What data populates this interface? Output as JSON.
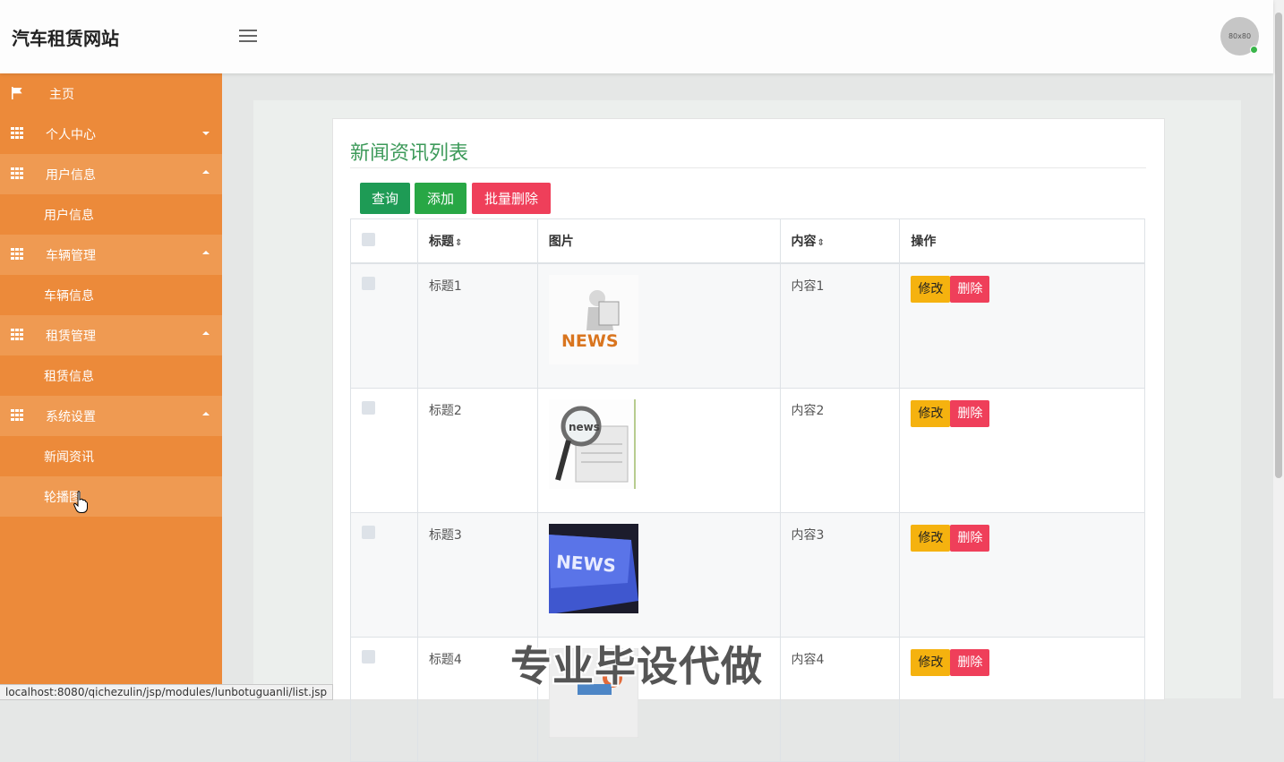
{
  "header": {
    "brand": "汽车租赁网站",
    "avatar_text": "80x80"
  },
  "sidebar": {
    "items": [
      {
        "label": "主页",
        "icon": "flag-icon",
        "type": "link"
      },
      {
        "label": "个人中心",
        "icon": "grid-icon",
        "type": "group",
        "expanded": false
      },
      {
        "label": "用户信息",
        "icon": "grid-icon",
        "type": "group",
        "expanded": true,
        "children": [
          "用户信息"
        ]
      },
      {
        "label": "车辆管理",
        "icon": "grid-icon",
        "type": "group",
        "expanded": true,
        "children": [
          "车辆信息"
        ]
      },
      {
        "label": "租赁管理",
        "icon": "grid-icon",
        "type": "group",
        "expanded": true,
        "children": [
          "租赁信息"
        ]
      },
      {
        "label": "系统设置",
        "icon": "grid-icon",
        "type": "group",
        "expanded": true,
        "children": [
          "新闻资讯",
          "轮播图"
        ]
      }
    ]
  },
  "main": {
    "title": "新闻资讯列表",
    "buttons": {
      "query": "查询",
      "add": "添加",
      "batch_delete": "批量删除"
    },
    "table": {
      "headers": {
        "title": "标题",
        "image": "图片",
        "content": "内容",
        "actions": "操作"
      },
      "rows": [
        {
          "title": "标题1",
          "content": "内容1",
          "image": "news-3d-figure-image"
        },
        {
          "title": "标题2",
          "content": "内容2",
          "image": "news-magnifier-image"
        },
        {
          "title": "标题3",
          "content": "内容3",
          "image": "news-keyboard-key-image"
        },
        {
          "title": "标题4",
          "content": "内容4",
          "image": "news-badge-image"
        }
      ],
      "edit_label": "修改",
      "delete_label": "删除"
    }
  },
  "statusbar": {
    "url": "localhost:8080/qichezulin/jsp/modules/lunbotuguanli/list.jsp"
  },
  "watermark": "专业毕设代做",
  "colors": {
    "sidebar": "#ec8a3a",
    "title": "#3d9a5a",
    "query": "#1e9b55",
    "add": "#28a745",
    "danger": "#ef3f5a",
    "warning": "#f5b20f"
  }
}
